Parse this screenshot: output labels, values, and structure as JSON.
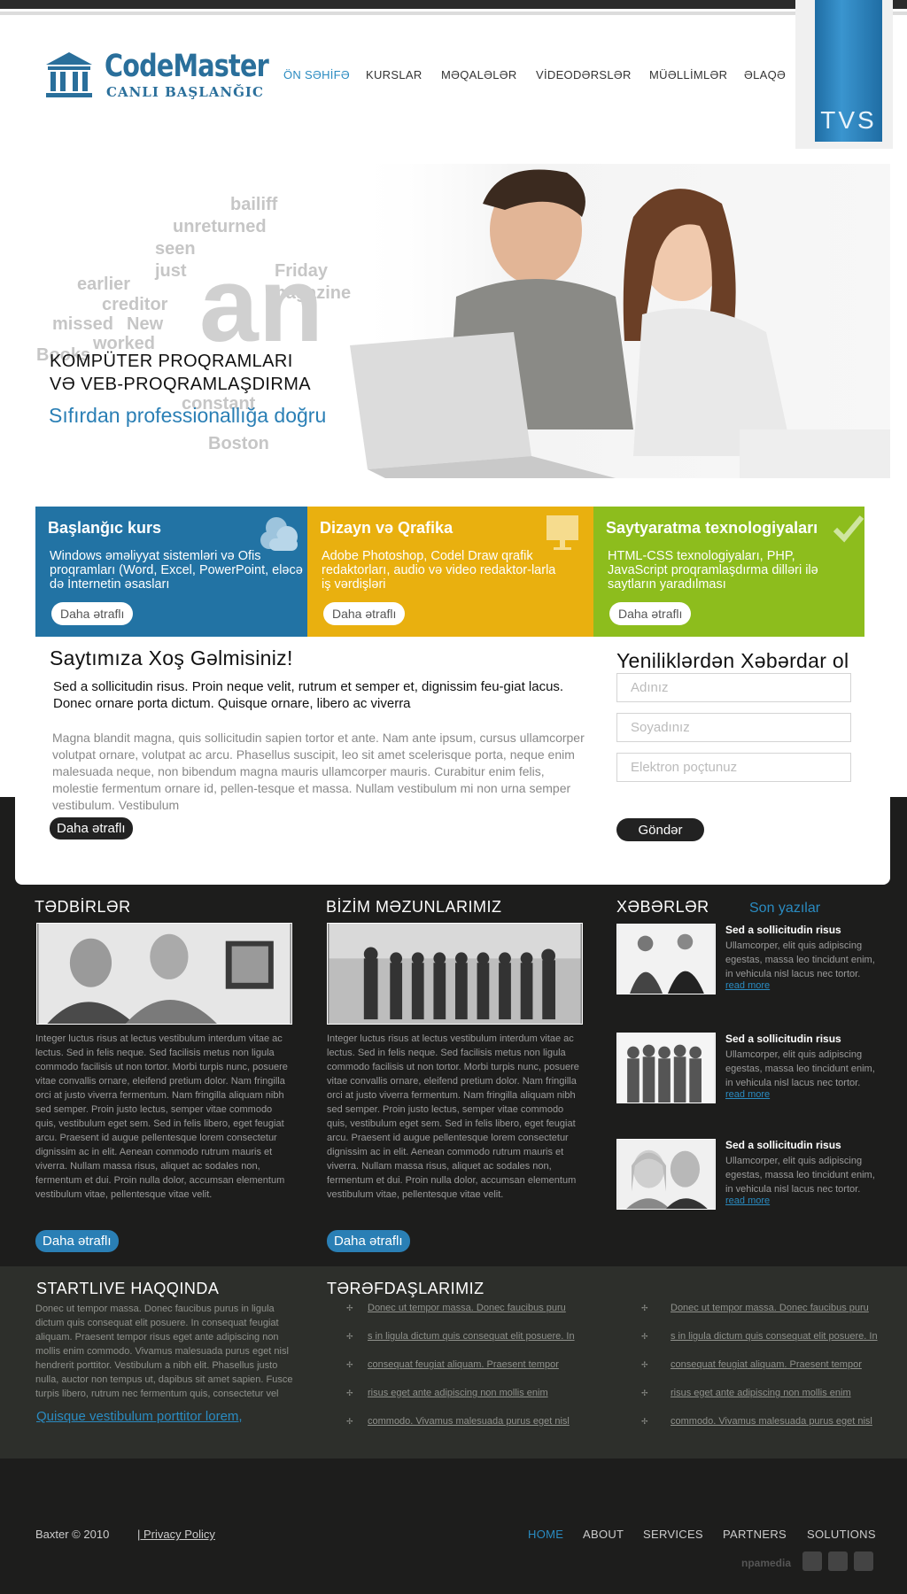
{
  "logo": {
    "title": "CodeMaster",
    "subtitle": "CANLI BAŞLANĞIC"
  },
  "nav": {
    "items": [
      "ÖN SƏHİFƏ",
      "KURSLAR",
      "MƏQALƏLƏR",
      "VİDEODƏRSLƏR",
      "MÜƏLLİMLƏR",
      "ƏLAQƏ"
    ],
    "active": "ÖN SƏHİFƏ"
  },
  "tvs_banner": {
    "label": "TVS"
  },
  "hero": {
    "title_line1": "KOMPÜTER PROQRAMLARI",
    "title_line2": "VƏ VEB-PROQRAMLAŞDIRMA",
    "tagline": "Sıfırdan professionallığa  doğru"
  },
  "features": [
    {
      "title": "Başlanğıc kurs",
      "description": "Windows əməliyyat sistemləri və Ofis proqramları (Word, Excel, PowerPoint, eləcə də İnternetin əsasları",
      "button": "Daha ətraflı",
      "icon": "cloud-icon",
      "color": "#2273a4"
    },
    {
      "title": "Dizayn və Qrafika",
      "description": "Adobe Photoshop, Codel Draw qrafik redaktorları, audio və video redaktor-larla iş vərdişləri",
      "button": "Daha ətraflı",
      "icon": "monitor-icon",
      "color": "#e9b00f"
    },
    {
      "title": "Saytyaratma texnologiyaları",
      "description": "HTML-CSS texnologiyaları, PHP, JavaScript proqramlaşdırma dilləri ilə saytların yaradılması",
      "button": "Daha ətraflı",
      "icon": "checkmark-icon",
      "color": "#8dbd1d"
    }
  ],
  "welcome": {
    "title": "Saytımıza Xoş Gəlmisiniz!",
    "lead": "Sed a sollicitudin risus. Proin neque velit, rutrum et semper et, dignissim feu-giat lacus. Donec ornare porta dictum. Quisque ornare, libero ac viverra",
    "body": "Magna blandit magna, quis sollicitudin sapien tortor et ante. Nam ante ipsum, cursus ullamcorper volutpat ornare, volutpat ac arcu. Phasellus suscipit, leo sit amet scelerisque porta, neque enim malesuada neque, non bibendum magna mauris ullamcorper mauris. Curabitur enim felis, molestie fermentum ornare id, pellen-tesque et massa. Nullam vestibulum mi non urna semper vestibulum. Vestibulum",
    "button": "Daha ətraflı"
  },
  "newsletter": {
    "title": "Yeniliklərdən Xəbərdar ol",
    "name_placeholder": "Adınız",
    "surname_placeholder": "Soyadınız",
    "email_placeholder": "Elektron poçtunuz",
    "submit": "Göndər"
  },
  "events": {
    "title": "TƏDBİRLƏR",
    "text": "Integer luctus risus at lectus vestibulum interdum vitae ac lectus. Sed in felis neque. Sed facilisis metus non ligula commodo facilisis ut non tortor. Morbi turpis nunc, posuere vitae convallis ornare, eleifend pretium dolor. Nam fringilla orci at justo viverra fermentum. Nam fringilla aliquam nibh sed semper. Proin justo lectus, semper vitae commodo quis, vestibulum eget sem. Sed in felis libero, eget feugiat arcu. Praesent id augue pellentesque lorem consectetur dignissim ac in elit. Aenean commodo rutrum mauris et viverra. Nullam massa risus, aliquet ac sodales non, fermentum et dui. Proin nulla dolor, accumsan elementum vestibulum vitae, pellentesque vitae velit.",
    "button": "Daha ətraflı"
  },
  "graduates": {
    "title": "BİZİM MƏZUNLARIMIZ",
    "text": "Integer luctus risus at lectus vestibulum interdum vitae ac lectus. Sed in felis neque. Sed facilisis metus non ligula commodo facilisis ut non tortor. Morbi turpis nunc, posuere vitae convallis ornare, eleifend pretium dolor. Nam fringilla orci at justo viverra fermentum. Nam fringilla aliquam nibh sed semper. Proin justo lectus, semper vitae commodo quis, vestibulum eget sem. Sed in felis libero, eget feugiat arcu. Praesent id augue pellentesque lorem consectetur dignissim ac in elit. Aenean commodo rutrum mauris et viverra. Nullam massa risus, aliquet ac sodales non, fermentum et dui. Proin nulla dolor, accumsan elementum vestibulum vitae, pellentesque vitae velit.",
    "button": "Daha ətraflı"
  },
  "news": {
    "title": "XƏBƏRLƏR",
    "recent_label": "Son yazılar",
    "items": [
      {
        "headline": "Sed a sollicitudin risus",
        "text": "Ullamcorper, elit quis adipiscing egestas, massa leo tincidunt enim, in vehicula nisl lacus nec tortor.",
        "link": "read more"
      },
      {
        "headline": "Sed a sollicitudin risus",
        "text": "Ullamcorper, elit quis adipiscing egestas, massa leo tincidunt enim, in vehicula nisl lacus nec tortor.",
        "link": "read more"
      },
      {
        "headline": "Sed a sollicitudin risus",
        "text": "Ullamcorper, elit quis adipiscing egestas, massa leo tincidunt enim, in vehicula nisl lacus nec tortor.",
        "link": "read more"
      }
    ]
  },
  "about": {
    "title": "STARTLIVE HAQQINDA",
    "text": "Donec ut tempor massa. Donec faucibus purus in ligula dictum quis consequat elit posuere. In consequat feugiat aliquam. Praesent tempor risus eget ante adipiscing non mollis enim commodo. Vivamus malesuada purus eget nisl hendrerit porttitor. Vestibulum a nibh elit. Phasellus justo nulla, auctor non tempus ut, dapibus sit amet sapien. Fusce turpis libero, rutrum nec fermentum quis, consectetur vel",
    "link": "Quisque vestibulum porttitor lorem,"
  },
  "partners": {
    "title": "TƏRƏFDAŞLARIMIZ",
    "col1": [
      "Donec ut tempor massa. Donec faucibus puru",
      "s in ligula dictum quis consequat elit posuere. In",
      "consequat feugiat aliquam. Praesent tempor",
      "risus eget ante adipiscing non mollis enim",
      "commodo. Vivamus malesuada purus eget nisl"
    ],
    "col2": [
      "Donec ut tempor massa. Donec faucibus puru",
      "s in ligula dictum quis consequat elit posuere. In",
      "consequat feugiat aliquam. Praesent tempor",
      "risus eget ante adipiscing non mollis enim",
      "commodo. Vivamus malesuada purus eget nisl"
    ]
  },
  "footer": {
    "copyright": "Baxter © 2010",
    "privacy": "|   Privacy Policy",
    "nav": [
      "HOME",
      "ABOUT",
      "SERVICES",
      "PARTNERS",
      "SOLUTIONS"
    ],
    "active": "HOME",
    "credit": "npamedia",
    "social_icons": [
      "twitter-icon",
      "flickr-icon",
      "delicious-icon"
    ]
  },
  "colors": {
    "brand_blue": "#2a7fb5",
    "feature_blue": "#2273a4",
    "feature_yellow": "#e9b00f",
    "feature_green": "#8dbd1d",
    "dark_bg": "#1d1d1c"
  }
}
